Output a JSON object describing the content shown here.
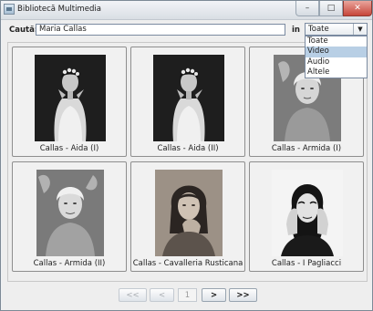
{
  "window": {
    "title": "Bibliotecă Multimedia",
    "controls": {
      "minimize": "–",
      "maximize": "□",
      "close": "✕"
    }
  },
  "search": {
    "label": "Caută:",
    "value": "Maria Callas",
    "scope_label": "in",
    "scope_selected": "Toate",
    "scope_options": [
      "Toate",
      "Video",
      "Audio",
      "Altele"
    ],
    "highlighted_option": "Video"
  },
  "items": [
    {
      "caption": "Callas - Aida (I)"
    },
    {
      "caption": "Callas - Aida (II)"
    },
    {
      "caption": "Callas - Armida (I)"
    },
    {
      "caption": "Callas - Armida (II)"
    },
    {
      "caption": "Callas - Cavalleria Rusticana"
    },
    {
      "caption": "Callas - I Pagliacci"
    }
  ],
  "pager": {
    "first": "<<",
    "prev": "<",
    "page": "1",
    "next": ">",
    "last": ">>"
  },
  "colors": {
    "selection": "#b8cfe5",
    "close_button": "#c7463a"
  }
}
